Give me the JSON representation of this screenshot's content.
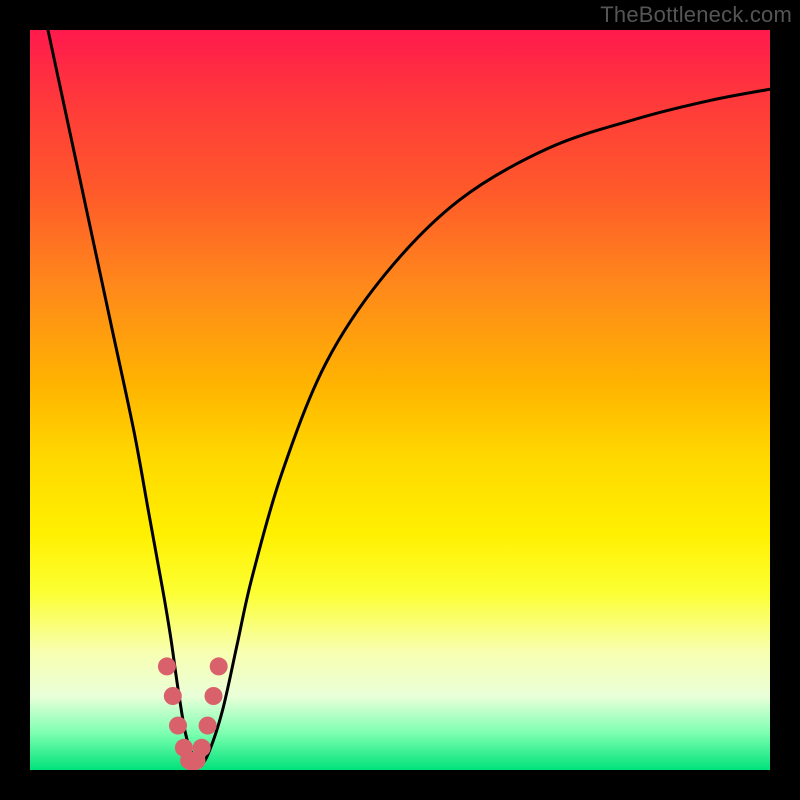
{
  "watermark": "TheBottleneck.com",
  "chart_data": {
    "type": "line",
    "title": "",
    "xlabel": "",
    "ylabel": "",
    "xlim": [
      0,
      100
    ],
    "ylim": [
      0,
      100
    ],
    "grid": false,
    "legend": false,
    "series": [
      {
        "name": "curve",
        "x": [
          2,
          5,
          8,
          11,
          14,
          16,
          18,
          19,
          20,
          21,
          22,
          23,
          24,
          26,
          28,
          30,
          34,
          40,
          48,
          58,
          70,
          82,
          92,
          100
        ],
        "y": [
          102,
          88,
          74,
          60,
          46,
          35,
          24,
          18,
          11,
          5,
          2,
          1,
          2,
          8,
          17,
          26,
          40,
          55,
          67,
          77,
          84,
          88,
          90.5,
          92
        ]
      }
    ],
    "markers": {
      "name": "highlight",
      "x": [
        18.5,
        19.3,
        20.0,
        20.8,
        21.5,
        22.0,
        22.5,
        23.2,
        24.0,
        24.8,
        25.5
      ],
      "y": [
        14,
        10,
        6,
        3,
        1.3,
        1,
        1.3,
        3,
        6,
        10,
        14
      ]
    },
    "background_gradient": {
      "top": "#ff1a4d",
      "mid": "#ffd900",
      "bottom": "#00e27a"
    }
  }
}
